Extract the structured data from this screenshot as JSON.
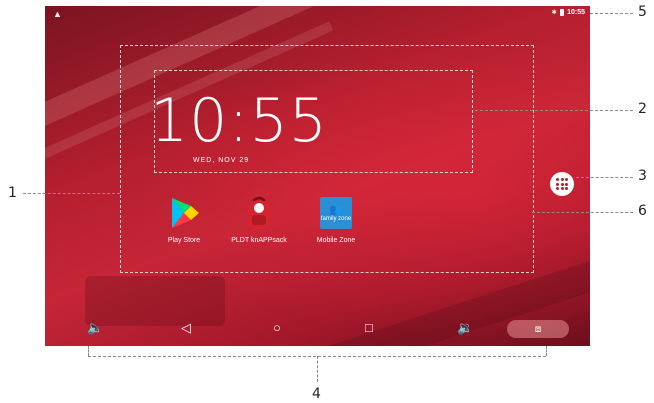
{
  "status_bar": {
    "alert_icon": "warning-icon",
    "bluetooth_icon": "bluetooth-icon",
    "battery_icon": "battery-icon",
    "time": "10:55"
  },
  "clock_widget": {
    "time": "10:55",
    "date": "WED, NOV 29"
  },
  "apps": [
    {
      "label": "Play Store",
      "icon": "play-store-icon"
    },
    {
      "label": "PLDT knAPPsack",
      "icon": "pldt-knappsack-icon",
      "icon_text_top": "PLDT",
      "icon_text_bottom": "APPS"
    },
    {
      "label": "Mobile Zone",
      "icon": "mobile-zone-icon",
      "icon_text": "family zone"
    }
  ],
  "launcher_button": {
    "icon": "app-drawer-icon"
  },
  "nav_bar": {
    "volume_down": "volume-down-icon",
    "back": "back-icon",
    "home": "home-icon",
    "recents": "recents-icon",
    "volume_up": "volume-up-icon",
    "screenshot": "camera-icon"
  },
  "callouts": [
    "1",
    "2",
    "3",
    "4",
    "5",
    "6"
  ],
  "colors": {
    "wallpaper": "#b51f2e",
    "callout_line": "#8a8a8a"
  }
}
